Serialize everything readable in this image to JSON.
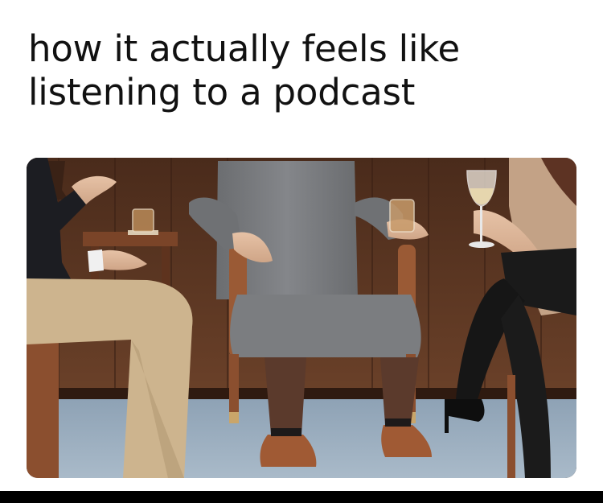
{
  "meme": {
    "caption_line1": "how it actually feels like",
    "caption_line2": "listening to a podcast"
  },
  "colors": {
    "background": "#ffffff",
    "text": "#111111",
    "wall": "#5a3522",
    "floor": "#9fb1c2",
    "chair_fabric": "#77797c",
    "wood": "#9a5a35",
    "trousers_left": "#cdb48e",
    "trousers_center": "#5b3a2c",
    "stockings": "#161616"
  }
}
